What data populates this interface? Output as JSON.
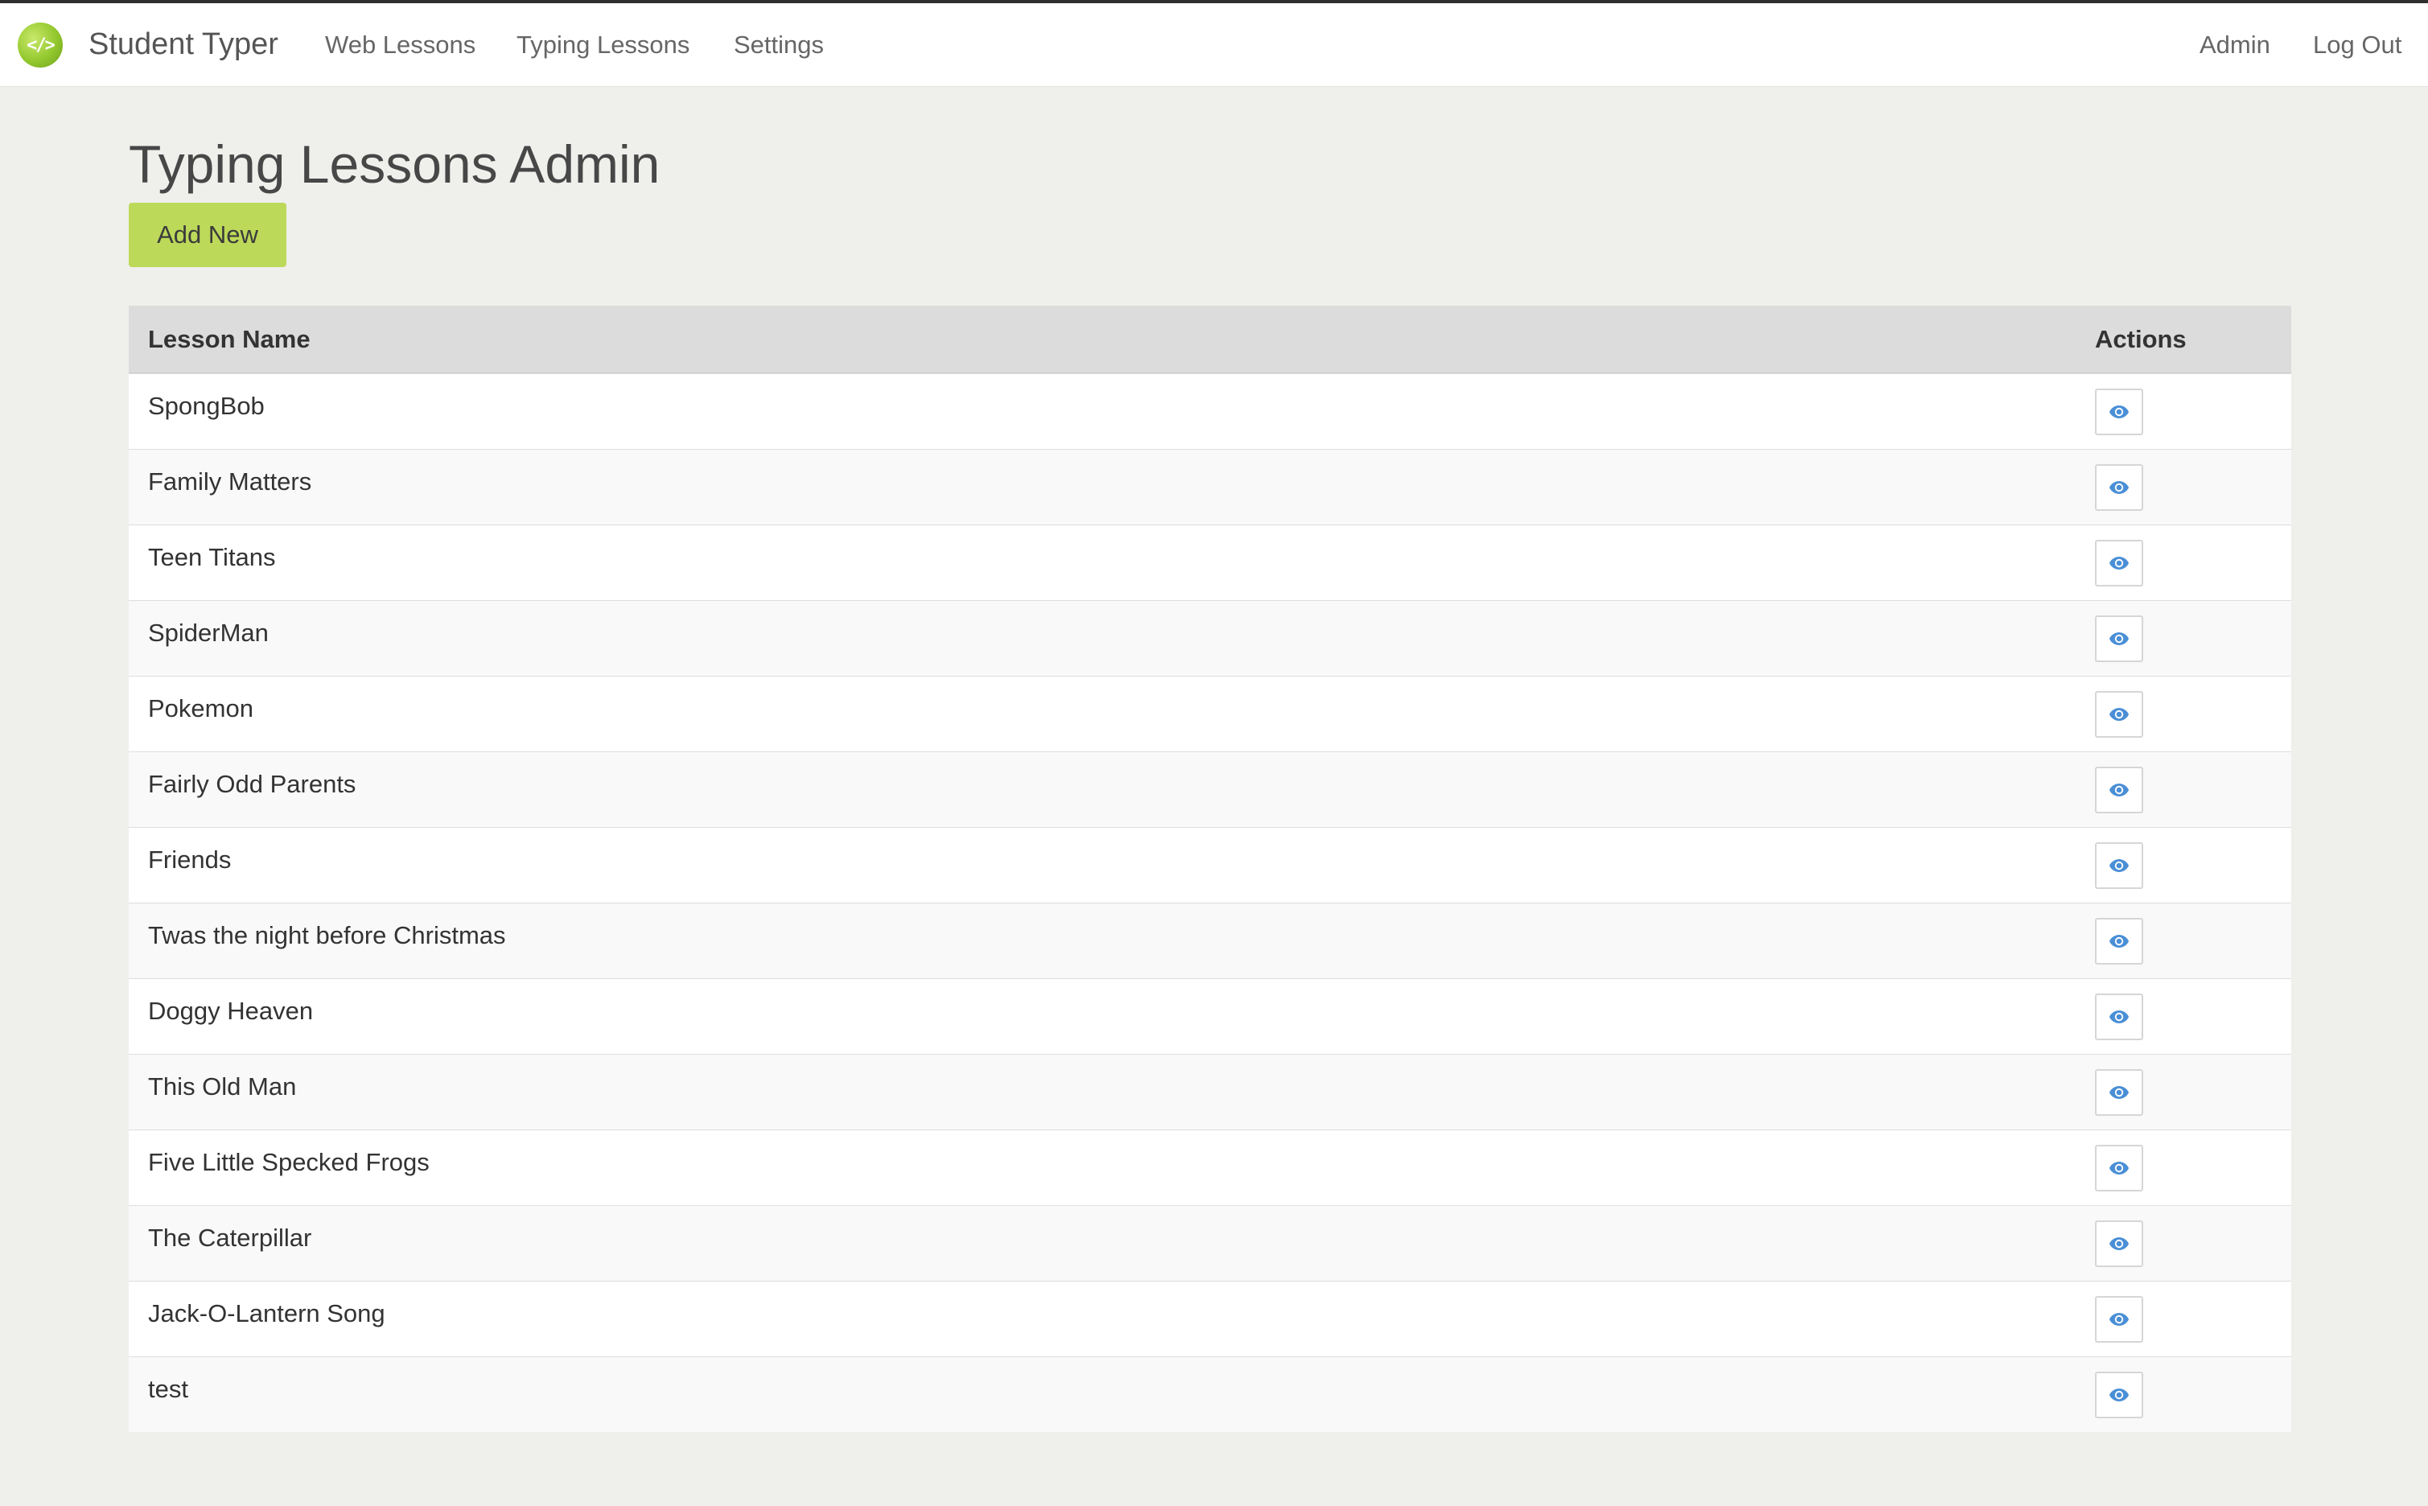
{
  "navbar": {
    "brand": "Student Typer",
    "links": [
      "Web Lessons",
      "Typing Lessons",
      "Settings"
    ],
    "right_links": [
      "Admin",
      "Log Out"
    ],
    "logo_glyph": "</>"
  },
  "page": {
    "title": "Typing Lessons Admin",
    "add_button": "Add New"
  },
  "table": {
    "columns": [
      "Lesson Name",
      "Actions"
    ],
    "rows": [
      "SpongBob",
      "Family Matters",
      "Teen Titans",
      "SpiderMan",
      "Pokemon",
      "Fairly Odd Parents",
      "Friends",
      "Twas the night before Christmas",
      "Doggy Heaven",
      "This Old Man",
      "Five Little Specked Frogs",
      "The Caterpillar",
      "Jack-O-Lantern Song",
      "test"
    ],
    "row_action_icon": "eye-icon"
  },
  "colors": {
    "accent": "#bcd95a",
    "icon": "#4a8fd6",
    "header_bg": "#dcdcdc",
    "page_bg": "#efefeb"
  }
}
